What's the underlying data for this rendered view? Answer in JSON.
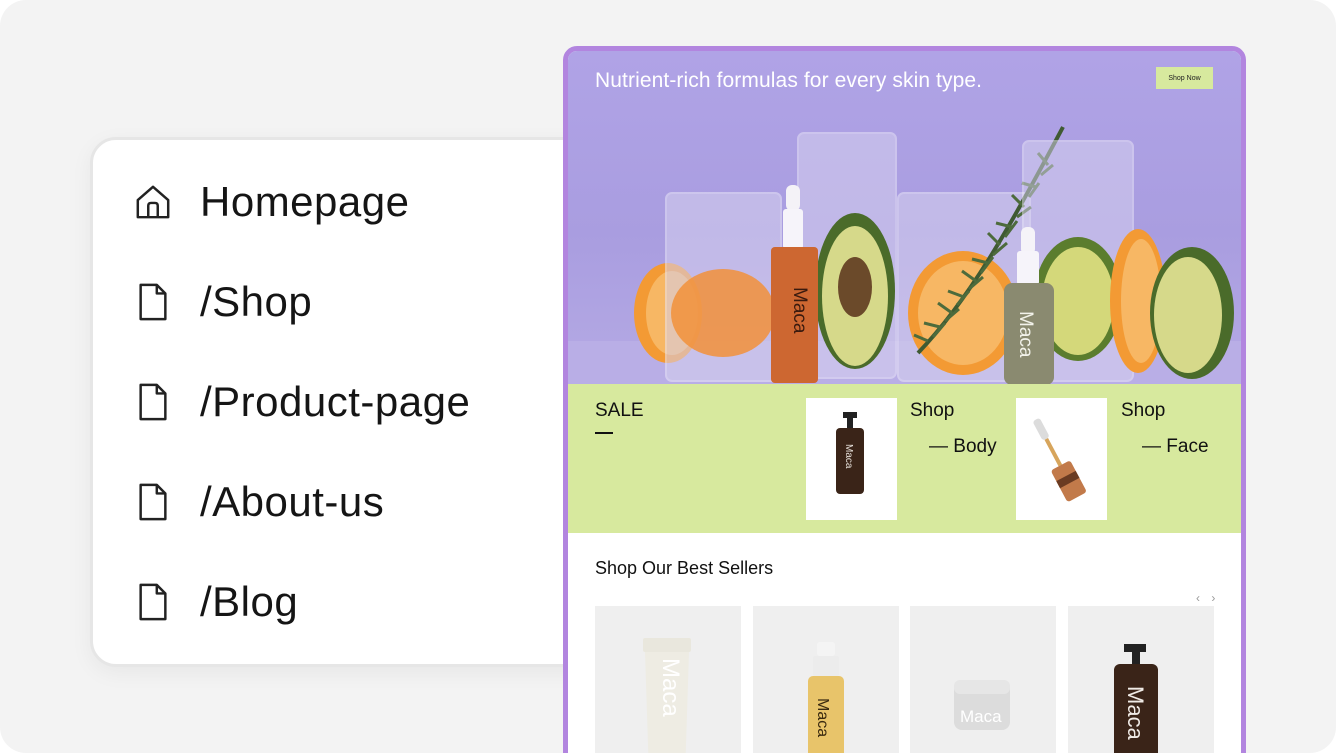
{
  "pages_panel": {
    "items": [
      {
        "label": "Homepage",
        "icon": "home-icon"
      },
      {
        "label": "/Shop",
        "icon": "file-icon"
      },
      {
        "label": "/Product-page",
        "icon": "file-icon"
      },
      {
        "label": "/About-us",
        "icon": "file-icon"
      },
      {
        "label": "/Blog",
        "icon": "file-icon"
      }
    ]
  },
  "site": {
    "hero": {
      "title": "Nutrient-rich formulas for every skin type.",
      "cta": "Shop Now",
      "bottle_brand": "Maca"
    },
    "sale": {
      "label": "SALE",
      "categories": [
        {
          "title": "Shop",
          "sub": "— Body"
        },
        {
          "title": "Shop",
          "sub": "— Face"
        }
      ]
    },
    "best_sellers": {
      "title": "Shop Our Best Sellers",
      "arrows": "‹ ›",
      "products": [
        {
          "brand": "Maca",
          "kind": "tube"
        },
        {
          "brand": "Maca",
          "kind": "spray"
        },
        {
          "brand": "Maca",
          "kind": "jar"
        },
        {
          "brand": "Maca",
          "kind": "pump"
        }
      ]
    }
  },
  "colors": {
    "accent_border": "#b285df",
    "hero_bg": "#a99de0",
    "lime": "#d7e99e"
  }
}
